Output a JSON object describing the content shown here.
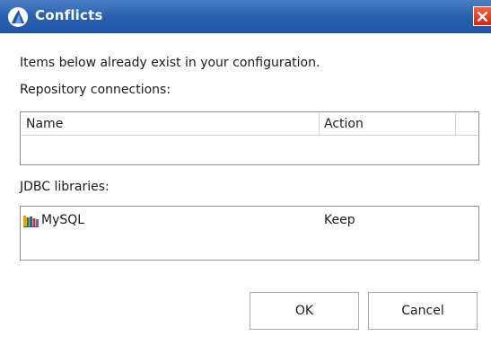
{
  "window": {
    "title": "Conflicts"
  },
  "message": "Items below already exist in your configuration.",
  "repository": {
    "label": "Repository connections:",
    "columns": [
      "Name",
      "Action"
    ]
  },
  "jdbc": {
    "label": "JDBC libraries:",
    "rows": [
      {
        "icon": "books-icon",
        "name": "MySQL",
        "action": "Keep"
      }
    ]
  },
  "buttons": {
    "ok": "OK",
    "cancel": "Cancel"
  },
  "colors": {
    "titlebar": "#2b63b0",
    "close": "#cf2a14"
  }
}
